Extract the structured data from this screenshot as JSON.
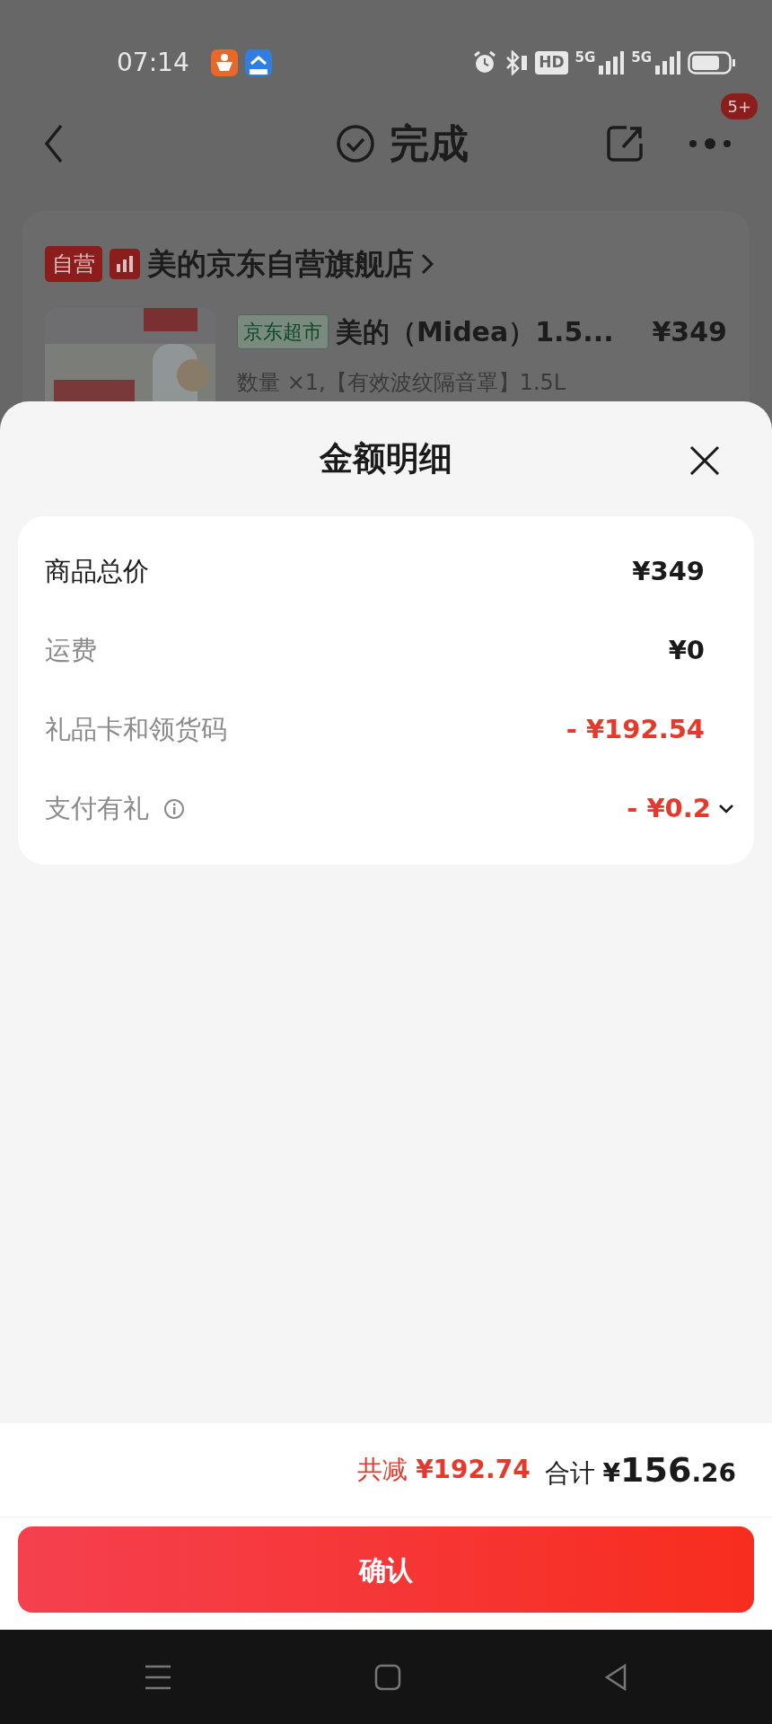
{
  "status_bar": {
    "time": "07:14",
    "hd_label": "HD",
    "networks": [
      "5G",
      "5G"
    ]
  },
  "header": {
    "title": "完成",
    "badge": "5+"
  },
  "store": {
    "tag": "自营",
    "name": "美的京东自营旗舰店",
    "product": {
      "kind": "picture",
      "tag": "京东超市",
      "title": "美的（Midea）1.5...",
      "price": "¥349",
      "spec": "数量 ×1,【有效波纹隔音罩】1.5L"
    }
  },
  "sheet": {
    "title": "金额明细",
    "rows": [
      {
        "kind": "total",
        "label": "商品总价",
        "value": "¥349"
      },
      {
        "kind": "fee",
        "label": "运费",
        "value": "¥0"
      },
      {
        "kind": "discount",
        "label": "礼品卡和领货码",
        "value": "- ¥192.54"
      },
      {
        "kind": "discount",
        "label": "支付有礼",
        "value": "- ¥0.2",
        "info": true,
        "expandable": true,
        "expanded": false
      }
    ]
  },
  "footer": {
    "saved_label": "共减",
    "saved_value": "¥192.74",
    "total_label": "合计",
    "total_currency": "¥",
    "total_integer": "156",
    "total_decimal": ".26",
    "confirm": "确认"
  }
}
